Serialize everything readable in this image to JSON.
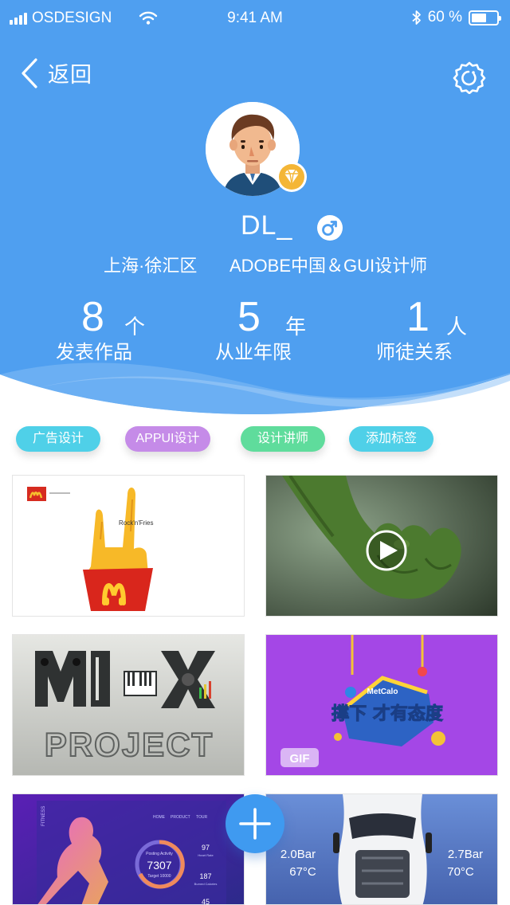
{
  "status_bar": {
    "carrier": "OSDESIGN",
    "time": "9:41 AM",
    "battery": "60 %",
    "battery_level": 0.6
  },
  "nav": {
    "back_label": "返回"
  },
  "profile": {
    "username": "DL_",
    "location": "上海·徐汇区",
    "title": "ADOBE中国＆GUI设计师"
  },
  "stats": [
    {
      "value": "8",
      "unit": "个",
      "label": "发表作品"
    },
    {
      "value": "5",
      "unit": "年",
      "label": "从业年限"
    },
    {
      "value": "1",
      "unit": "人",
      "label": "师徒关系"
    }
  ],
  "tags": [
    {
      "label": "广告设计",
      "color": "#4fd0e8"
    },
    {
      "label": "APPUI设计",
      "color": "#c58be8"
    },
    {
      "label": "设计讲师",
      "color": "#5fdc9c"
    },
    {
      "label": "添加标签",
      "color": "#4fd0e8"
    }
  ],
  "works": {
    "card1": {
      "text": "Rock'n'Fries"
    },
    "card3": {
      "top": "MIX",
      "bottom": "PROJECT"
    },
    "card4": {
      "brand": "MetCalo",
      "text": "撑下 才有态度",
      "tag": "GIF"
    },
    "card5": {
      "side_label": "FITNESS",
      "nav": [
        "HOME",
        "PRODUCT",
        "TOUR"
      ],
      "activity_title": "Posting Activity",
      "activity_value": "7307",
      "activity_target": "Target 10000",
      "heart_value": "97",
      "heart_label": "Heart Rate",
      "cal_value": "187",
      "cal_label": "Burned Calories",
      "extra_value": "45"
    },
    "card6": {
      "left_pressure": "2.0Bar",
      "left_temp": "67°C",
      "right_pressure": "2.7Bar",
      "right_temp": "70°C"
    }
  },
  "colors": {
    "header_blue": "#4f9ff0",
    "accent": "#3f9af0"
  }
}
